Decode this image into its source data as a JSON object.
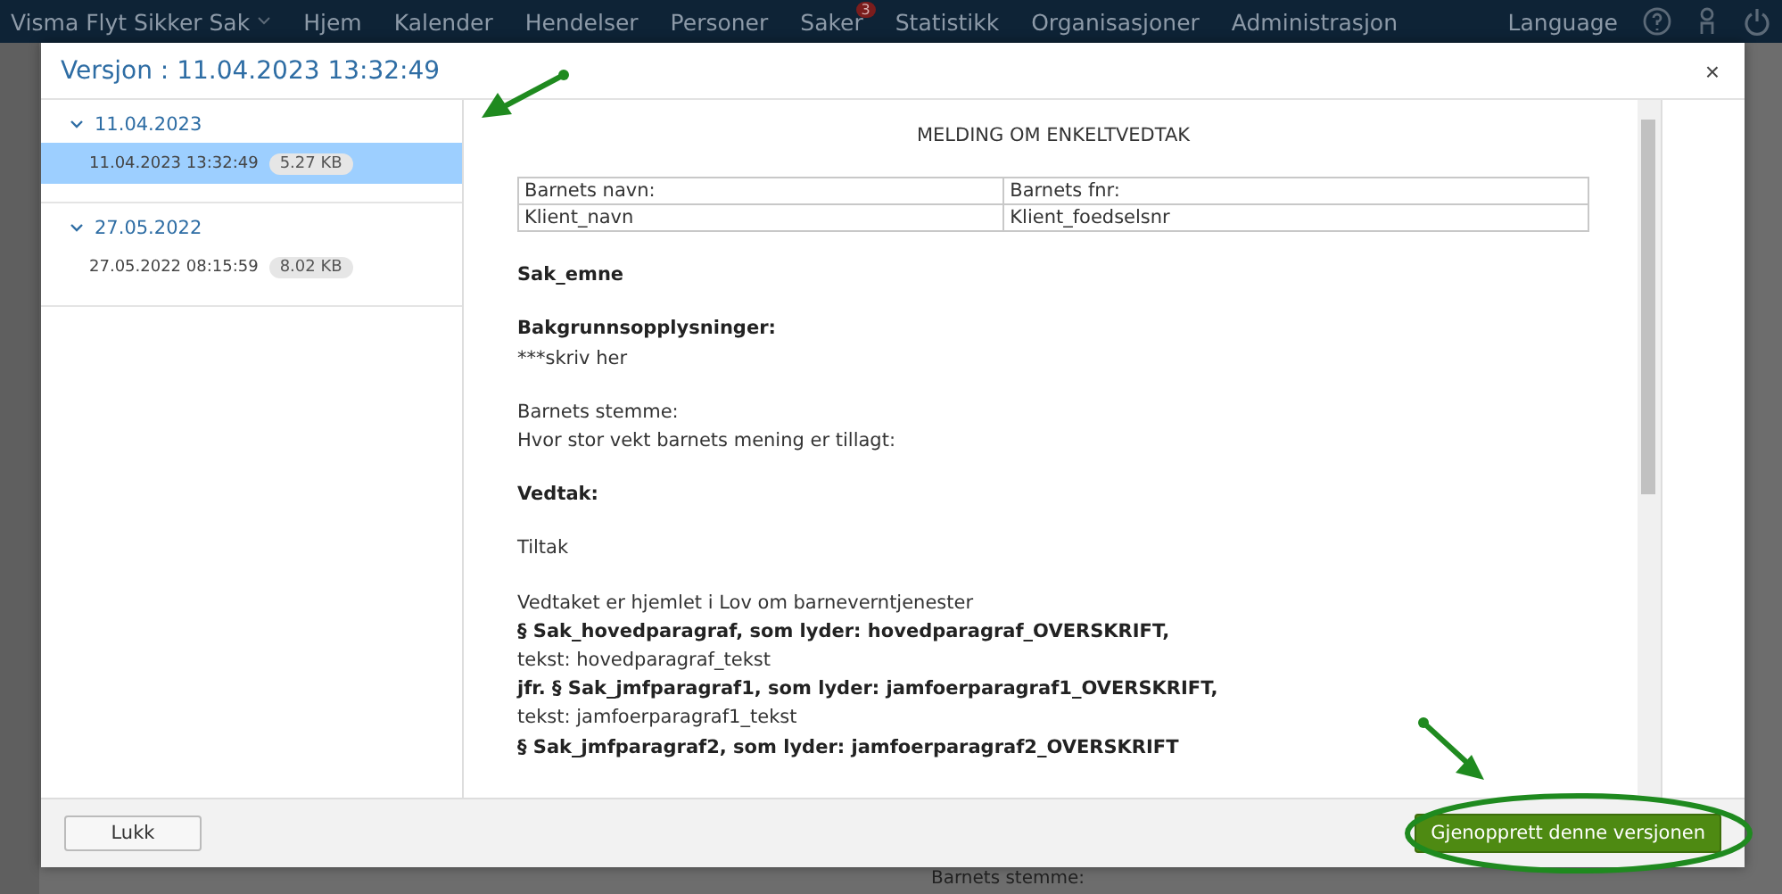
{
  "top_nav": {
    "brand": "Visma Flyt Sikker Sak",
    "items": [
      {
        "label": "Hjem"
      },
      {
        "label": "Kalender"
      },
      {
        "label": "Hendelser"
      },
      {
        "label": "Personer"
      },
      {
        "label": "Saker",
        "badge": "3"
      },
      {
        "label": "Statistikk"
      },
      {
        "label": "Organisasjoner"
      },
      {
        "label": "Administrasjon"
      }
    ],
    "language": "Language"
  },
  "background_text": "Barnets stemme:",
  "dialog": {
    "title": "Versjon : 11.04.2023 13:32:49",
    "close": "×",
    "versions": [
      {
        "date": "11.04.2023",
        "expanded": true,
        "entries": [
          {
            "timestamp": "11.04.2023 13:32:49",
            "size": "5.27 KB",
            "selected": true
          }
        ]
      },
      {
        "date": "27.05.2022",
        "expanded": true,
        "entries": [
          {
            "timestamp": "27.05.2022 08:15:59",
            "size": "8.02 KB",
            "selected": false
          }
        ]
      }
    ],
    "document": {
      "title": "MELDING OM ENKELTVEDTAK",
      "table": [
        [
          "Barnets navn:",
          "Barnets fnr:"
        ],
        [
          "Klient_navn",
          "Klient_foedselsnr"
        ]
      ],
      "sections": [
        {
          "lines": [
            {
              "kind": "bold",
              "text": "Sak_emne"
            }
          ]
        },
        {
          "lines": [
            {
              "kind": "bold",
              "text": "Bakgrunnsopplysninger:"
            },
            {
              "kind": "plain",
              "text": "***skriv her"
            }
          ]
        },
        {
          "lines": [
            {
              "kind": "plain",
              "text": "Barnets stemme:"
            },
            {
              "kind": "plain",
              "text": "Hvor stor vekt barnets mening er tillagt:"
            }
          ]
        },
        {
          "lines": [
            {
              "kind": "bold",
              "text": "Vedtak:"
            }
          ]
        },
        {
          "lines": [
            {
              "kind": "plain",
              "text": "Tiltak"
            }
          ]
        },
        {
          "lines": [
            {
              "kind": "plain",
              "text": "Vedtaket er hjemlet i Lov om barneverntjenester"
            },
            {
              "kind": "bold",
              "text": "§ Sak_hovedparagraf, som lyder: hovedparagraf_OVERSKRIFT,"
            },
            {
              "kind": "plain",
              "text": "tekst: hovedparagraf_tekst"
            },
            {
              "kind": "bold",
              "text": "jfr. § Sak_jmfparagraf1, som lyder: jamfoerparagraf1_OVERSKRIFT,"
            },
            {
              "kind": "plain",
              "text": "tekst: jamfoerparagraf1_tekst"
            },
            {
              "kind": "bold",
              "text": "§ Sak_jmfparagraf2, som lyder: jamfoerparagraf2_OVERSKRIFT"
            }
          ]
        }
      ]
    },
    "buttons": [
      {
        "kind": "secondary",
        "label": "Lukk"
      },
      {
        "kind": "primary",
        "label": "Gjenopprett denne versjonen"
      }
    ]
  }
}
